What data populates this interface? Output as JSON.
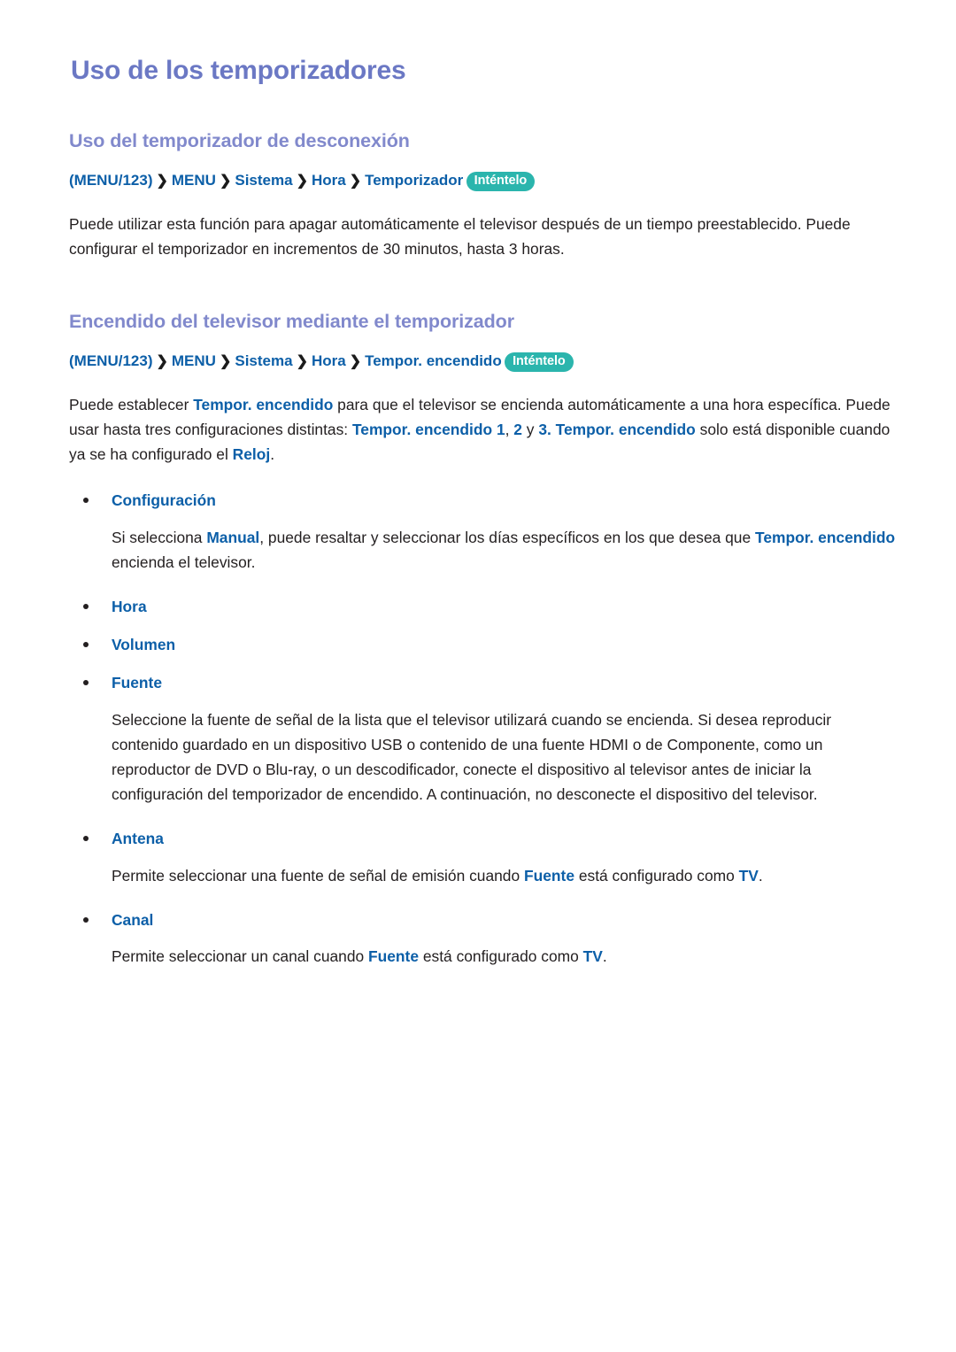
{
  "page": {
    "title": "Uso de los temporizadores",
    "colors": {
      "h1": "#6b78c4",
      "h2": "#8189cc",
      "accent_blue": "#0c5fa8",
      "badge_teal": "#2bb5ad",
      "body_text": "#231f20",
      "background": "#ffffff"
    }
  },
  "sections": [
    {
      "heading": "Uso del temporizador de desconexión",
      "breadcrumb": {
        "open_paren": "(",
        "close_paren": ")",
        "root": "MENU/123",
        "separator": "❯",
        "crumbs": [
          "MENU",
          "Sistema",
          "Hora",
          "Temporizador"
        ],
        "badge": "Inténtelo"
      },
      "paragraph": "Puede utilizar esta función para apagar automáticamente el televisor después de un tiempo preestablecido. Puede configurar el temporizador en incrementos de 30 minutos, hasta 3 horas."
    },
    {
      "heading": "Encendido del televisor mediante el temporizador",
      "breadcrumb": {
        "open_paren": "(",
        "close_paren": ")",
        "root": "MENU/123",
        "separator": "❯",
        "crumbs": [
          "MENU",
          "Sistema",
          "Hora",
          "Tempor. encendido"
        ],
        "badge": "Inténtelo"
      },
      "paragraph_parts": {
        "t1": "Puede establecer ",
        "a1": "Tempor. encendido",
        "t2": " para que el televisor se encienda automáticamente a una hora específica. Puede usar hasta tres configuraciones distintas: ",
        "a2": "Tempor. encendido 1",
        "t3": ", ",
        "a3": "2",
        "t4": " y ",
        "a4": "3. Tempor. encendido",
        "t5": " solo está disponible cuando ya se ha configurado el ",
        "a5": "Reloj",
        "t6": "."
      }
    }
  ],
  "bullets": [
    {
      "label": "Configuración",
      "body_parts": {
        "t1": "Si selecciona ",
        "a1": "Manual",
        "t2": ", puede resaltar y seleccionar los días específicos en los que desea que ",
        "a2": "Tempor. encendido",
        "t3": " encienda el televisor."
      }
    },
    {
      "label": "Hora"
    },
    {
      "label": "Volumen"
    },
    {
      "label": "Fuente",
      "body": "Seleccione la fuente de señal de la lista que el televisor utilizará cuando se encienda. Si desea reproducir contenido guardado en un dispositivo USB o contenido de una fuente HDMI o de Componente, como un reproductor de DVD o Blu-ray, o un descodificador, conecte el dispositivo al televisor antes de iniciar la configuración del temporizador de encendido. A continuación, no desconecte el dispositivo del televisor."
    },
    {
      "label": "Antena",
      "body_parts": {
        "t1": "Permite seleccionar una fuente de señal de emisión cuando ",
        "a1": "Fuente",
        "t2": " está configurado como ",
        "a2": "TV",
        "t3": "."
      }
    },
    {
      "label": "Canal",
      "body_parts": {
        "t1": "Permite seleccionar un canal cuando ",
        "a1": "Fuente",
        "t2": " está configurado como ",
        "a2": "TV",
        "t3": "."
      }
    }
  ]
}
